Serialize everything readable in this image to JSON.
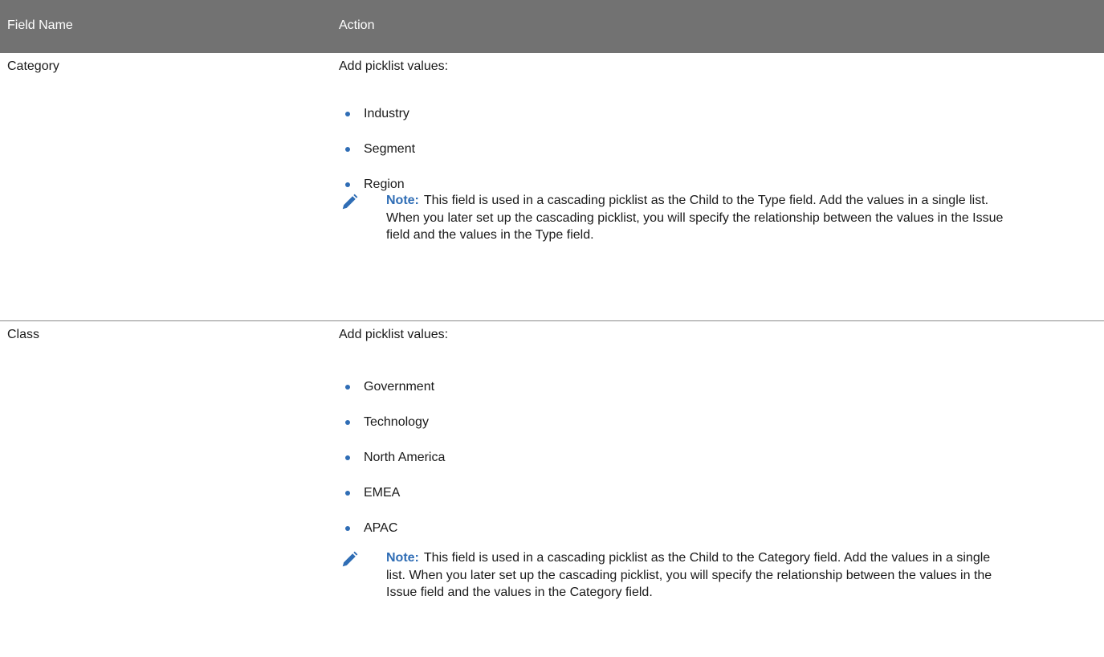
{
  "table": {
    "headers": {
      "field_name": "Field Name",
      "action": "Action"
    },
    "rows": [
      {
        "field_name": "Category",
        "action_intro": "Add picklist values:",
        "values": [
          "Industry",
          "Segment",
          "Region"
        ],
        "note_label": "Note:",
        "note_text": "This field is used in a cascading picklist as the Child to the Type field. Add the values in a single list. When you later set up the cascading picklist, you will specify the relationship between the values in the Issue field and the values in the Type field."
      },
      {
        "field_name": "Class",
        "action_intro": "Add picklist values:",
        "values": [
          "Government",
          "Technology",
          "North America",
          "EMEA",
          "APAC"
        ],
        "note_label": "Note:",
        "note_text": "This field is used in a cascading picklist as the Child to the Category field. Add the values in a single list. When you later set up the cascading picklist, you will specify the relationship between the values in the Issue field and the values in the Category field."
      }
    ]
  },
  "colors": {
    "header_background": "#727272",
    "accent_blue": "#2f6db5"
  },
  "icons": {
    "note": "pencil-icon",
    "bullet": "bullet-dot"
  }
}
